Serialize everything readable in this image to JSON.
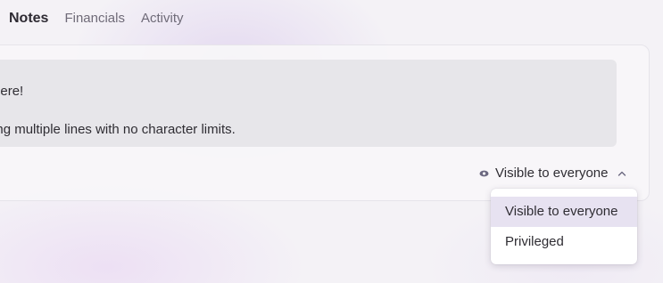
{
  "tabs": [
    {
      "label": "Notes",
      "active": true
    },
    {
      "label": "Financials",
      "active": false
    },
    {
      "label": "Activity",
      "active": false
    }
  ],
  "note": {
    "line1": "ote here!",
    "line2": "anning multiple lines with no character limits."
  },
  "visibility": {
    "icon": "eye-icon",
    "selected": "Visible to everyone",
    "chevron": "chevron-up-icon"
  },
  "dropdown": {
    "options": [
      "Visible to everyone",
      "Privileged"
    ],
    "highlighted": "Visible to everyone"
  },
  "colors": {
    "highlight": "#e7e2f1",
    "text": "#2f2d33",
    "muted": "#6f6b78",
    "accent": "#6b6880"
  }
}
